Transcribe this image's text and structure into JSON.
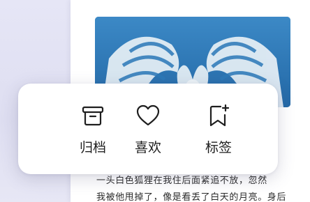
{
  "article": {
    "line1": "一头白色狐狸在我住后面紧追不放，忽然",
    "line2": "我被他甩掉了，像是看丢了白天的月亮。身后"
  },
  "popup": {
    "actions": [
      {
        "label": "归档",
        "icon": "archive-box-icon"
      },
      {
        "label": "喜欢",
        "icon": "heart-icon"
      },
      {
        "label": "标签",
        "icon": "bookmark-plus-icon"
      }
    ]
  },
  "colors": {
    "photo_blue": "#2b78b8",
    "text": "#1e1e1e",
    "background": "#e9e9f5"
  }
}
